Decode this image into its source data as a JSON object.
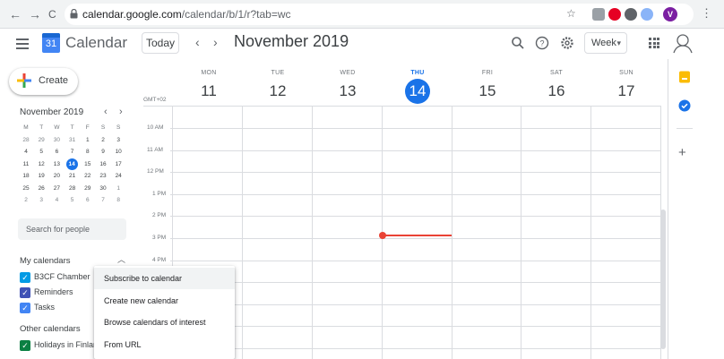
{
  "browser": {
    "back": "←",
    "forward": "→",
    "reload": "C",
    "url_host": "calendar.google.com",
    "url_path": "/calendar/b/1/r?tab=wc",
    "star": "☆",
    "profile_initial": "V",
    "menu": "⋮"
  },
  "header": {
    "app_title": "Calendar",
    "logo_day": "31",
    "today_label": "Today",
    "prev_arrow": "‹",
    "next_arrow": "›",
    "period_title": "November 2019",
    "view_label": "Week",
    "search_icon": "⌕",
    "help_icon": "?",
    "settings_icon": "⚙"
  },
  "sidebar": {
    "create_label": "Create",
    "mini_calendar": {
      "title": "November 2019",
      "prev": "‹",
      "next": "›",
      "weekdays": [
        "M",
        "T",
        "W",
        "T",
        "F",
        "S",
        "S"
      ],
      "weeks": [
        [
          "28",
          "29",
          "30",
          "31",
          "1",
          "2",
          "3"
        ],
        [
          "4",
          "5",
          "6",
          "7",
          "8",
          "9",
          "10"
        ],
        [
          "11",
          "12",
          "13",
          "14",
          "15",
          "16",
          "17"
        ],
        [
          "18",
          "19",
          "20",
          "21",
          "22",
          "23",
          "24"
        ],
        [
          "25",
          "26",
          "27",
          "28",
          "29",
          "30",
          "1"
        ],
        [
          "2",
          "3",
          "4",
          "5",
          "6",
          "7",
          "8"
        ]
      ],
      "today": "14"
    },
    "search_placeholder": "Search for people",
    "my_calendars": {
      "title": "My calendars",
      "items": [
        {
          "label": "B3CF Chamber",
          "color": "#039be5"
        },
        {
          "label": "Reminders",
          "color": "#3f51b5"
        },
        {
          "label": "Tasks",
          "color": "#4285f4"
        }
      ]
    },
    "other_calendars": {
      "title": "Other calendars",
      "items": [
        {
          "label": "Holidays in Finland",
          "color": "#0b8043"
        }
      ]
    }
  },
  "week": {
    "timezone": "GMT+02",
    "days": [
      {
        "name": "MON",
        "num": "11"
      },
      {
        "name": "TUE",
        "num": "12"
      },
      {
        "name": "WED",
        "num": "13"
      },
      {
        "name": "THU",
        "num": "14"
      },
      {
        "name": "FRI",
        "num": "15"
      },
      {
        "name": "SAT",
        "num": "16"
      },
      {
        "name": "SUN",
        "num": "17"
      }
    ],
    "hours": [
      "10 AM",
      "11 AM",
      "12 PM",
      "1 PM",
      "2 PM",
      "3 PM",
      "4 PM"
    ],
    "active_day": "THU"
  },
  "add_calendar_menu": {
    "items": [
      "Subscribe to calendar",
      "Create new calendar",
      "Browse calendars of interest",
      "From URL"
    ]
  },
  "colors": {
    "accent": "#1a73e8",
    "now_indicator": "#ea4335"
  }
}
